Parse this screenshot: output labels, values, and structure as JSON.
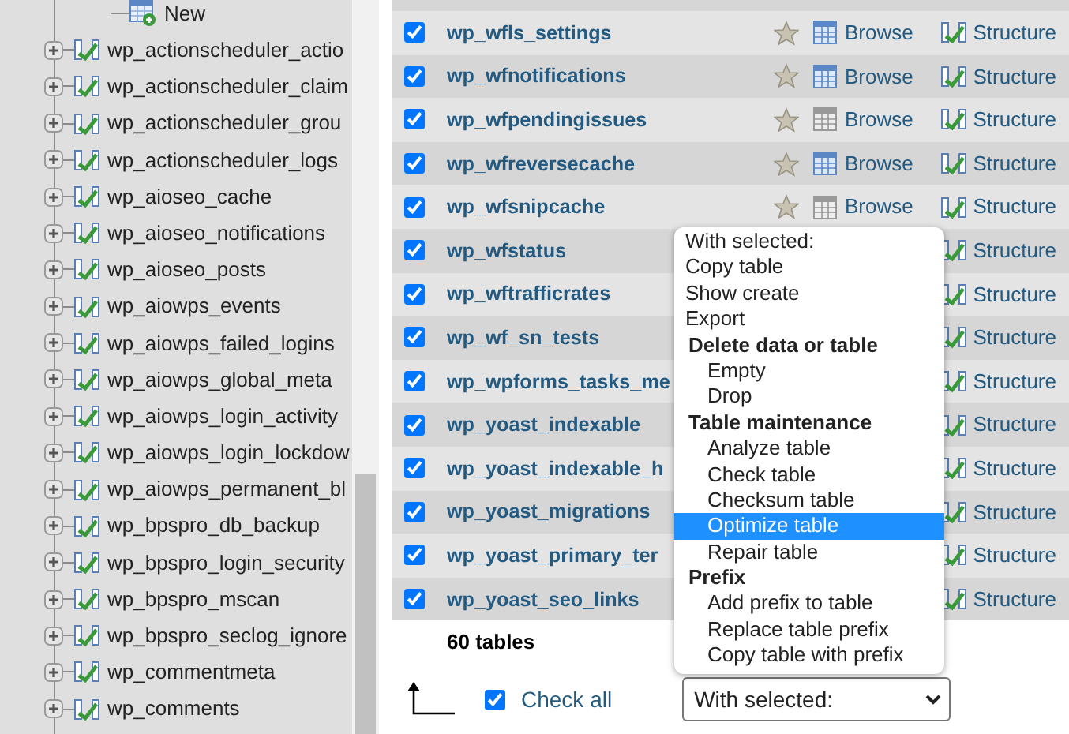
{
  "sidebar": {
    "new_item": "New",
    "tables": [
      {
        "name": "wp_actionscheduler_actio"
      },
      {
        "name": "wp_actionscheduler_claim"
      },
      {
        "name": "wp_actionscheduler_grou"
      },
      {
        "name": "wp_actionscheduler_logs"
      },
      {
        "name": "wp_aioseo_cache"
      },
      {
        "name": "wp_aioseo_notifications"
      },
      {
        "name": "wp_aioseo_posts"
      },
      {
        "name": "wp_aiowps_events"
      },
      {
        "name": "wp_aiowps_failed_logins"
      },
      {
        "name": "wp_aiowps_global_meta"
      },
      {
        "name": "wp_aiowps_login_activity"
      },
      {
        "name": "wp_aiowps_login_lockdow"
      },
      {
        "name": "wp_aiowps_permanent_bl"
      },
      {
        "name": "wp_bpspro_db_backup"
      },
      {
        "name": "wp_bpspro_login_security"
      },
      {
        "name": "wp_bpspro_mscan"
      },
      {
        "name": "wp_bpspro_seclog_ignore"
      },
      {
        "name": "wp_commentmeta"
      },
      {
        "name": "wp_comments"
      }
    ]
  },
  "table": {
    "rows": [
      {
        "kind": "full",
        "name": "wp_wfls_settings",
        "checked": true,
        "empty": false,
        "browse": "Browse",
        "structure": "Structure"
      },
      {
        "kind": "full",
        "name": "wp_wfnotifications",
        "checked": true,
        "empty": false,
        "browse": "Browse",
        "structure": "Structure"
      },
      {
        "kind": "full",
        "name": "wp_wfpendingissues",
        "checked": true,
        "empty": true,
        "browse": "Browse",
        "structure": "Structure"
      },
      {
        "kind": "full",
        "name": "wp_wfreversecache",
        "checked": true,
        "empty": false,
        "browse": "Browse",
        "structure": "Structure"
      },
      {
        "kind": "full",
        "name": "wp_wfsnipcache",
        "checked": true,
        "empty": true,
        "browse": "Browse",
        "structure": "Structure"
      },
      {
        "kind": "partial",
        "name": "wp_wfstatus",
        "checked": true,
        "structure": "Structure"
      },
      {
        "kind": "partial",
        "name": "wp_wftrafficrates",
        "checked": true,
        "structure": "Structure"
      },
      {
        "kind": "partial",
        "name": "wp_wf_sn_tests",
        "checked": true,
        "structure": "Structure"
      },
      {
        "kind": "partial",
        "name": "wp_wpforms_tasks_me",
        "checked": true,
        "structure": "Structure"
      },
      {
        "kind": "partial",
        "name": "wp_yoast_indexable",
        "checked": true,
        "structure": "Structure"
      },
      {
        "kind": "partial",
        "name": "wp_yoast_indexable_h",
        "checked": true,
        "structure": "Structure"
      },
      {
        "kind": "partial",
        "name": "wp_yoast_migrations",
        "checked": true,
        "structure": "Structure"
      },
      {
        "kind": "partial",
        "name": "wp_yoast_primary_ter",
        "checked": true,
        "structure": "Structure"
      },
      {
        "kind": "partial",
        "name": "wp_yoast_seo_links",
        "checked": true,
        "structure": "Structure"
      }
    ],
    "summary": "60 tables"
  },
  "footer": {
    "check_all": {
      "label": "Check all",
      "checked": true
    },
    "select": {
      "value": "With selected:"
    }
  },
  "dropdown": {
    "items": [
      {
        "kind": "option",
        "label": "With selected:",
        "selected": false
      },
      {
        "kind": "option",
        "label": "Copy table",
        "selected": false
      },
      {
        "kind": "option",
        "label": "Show create",
        "selected": false
      },
      {
        "kind": "option",
        "label": "Export",
        "selected": false
      },
      {
        "kind": "group",
        "label": "Delete data or table",
        "children": [
          {
            "kind": "option",
            "label": "Empty",
            "selected": false
          },
          {
            "kind": "option",
            "label": "Drop",
            "selected": false
          }
        ]
      },
      {
        "kind": "group",
        "label": "Table maintenance",
        "children": [
          {
            "kind": "option",
            "label": "Analyze table",
            "selected": false
          },
          {
            "kind": "option",
            "label": "Check table",
            "selected": false
          },
          {
            "kind": "option",
            "label": "Checksum table",
            "selected": false
          },
          {
            "kind": "option",
            "label": "Optimize table",
            "selected": true
          },
          {
            "kind": "option",
            "label": "Repair table",
            "selected": false
          }
        ]
      },
      {
        "kind": "group",
        "label": "Prefix",
        "children": [
          {
            "kind": "option",
            "label": "Add prefix to table",
            "selected": false
          },
          {
            "kind": "option",
            "label": "Replace table prefix",
            "selected": false
          },
          {
            "kind": "option",
            "label": "Copy table with prefix",
            "selected": false
          }
        ]
      }
    ]
  }
}
